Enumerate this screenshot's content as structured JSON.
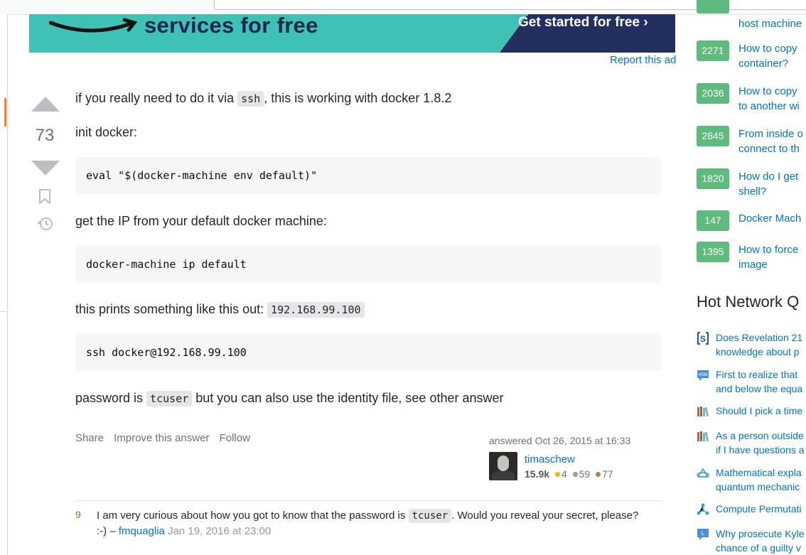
{
  "ad": {
    "headline": "services for free",
    "cta": "Get started for free ›",
    "report_link": "Report this ad"
  },
  "answer": {
    "score": "73",
    "p1_before": "if you really need to do it via ",
    "p1_code": "ssh",
    "p1_after": ", this is working with docker 1.8.2",
    "p2": "init docker:",
    "code1": "eval \"$(docker-machine env default)\"",
    "p3": "get the IP from your default docker machine:",
    "code2": "docker-machine ip default",
    "p4_before": "this prints something like this out: ",
    "p4_code": "192.168.99.100",
    "code3": "ssh docker@192.168.99.100",
    "p5_before": "password is ",
    "p5_code": "tcuser",
    "p5_after": " but you can also use the identity file, see other answer"
  },
  "actions": {
    "share": "Share",
    "improve": "Improve this answer",
    "follow": "Follow"
  },
  "author": {
    "answered": "answered Oct 26, 2015 at 16:33",
    "name": "timaschew",
    "reputation": "15.9k",
    "gold": "4",
    "silver": "59",
    "bronze": "77",
    "colors": {
      "gold": "#f1b600",
      "silver": "#9a9c9f",
      "bronze": "#ab825f"
    }
  },
  "comment": {
    "score": "9",
    "text_before": "I am very curious about how you got to know that the password is ",
    "code": "tcuser",
    "text_after": ". Would you reveal your secret, please? :-) – ",
    "user": "fmquaglia",
    "date": "Jan 19, 2016 at 23:00"
  },
  "linked": [
    {
      "count": "",
      "title_l1": "host machine",
      "title_l2": ""
    },
    {
      "count": "2271",
      "title_l1": "How to copy",
      "title_l2": "container?"
    },
    {
      "count": "2036",
      "title_l1": "How to copy",
      "title_l2": "to another wi"
    },
    {
      "count": "2845",
      "title_l1": "From inside o",
      "title_l2": "connect to th"
    },
    {
      "count": "1820",
      "title_l1": "How do I get",
      "title_l2": "shell?"
    },
    {
      "count": "147",
      "title_l1": "Docker Mach",
      "title_l2": ""
    },
    {
      "count": "1395",
      "title_l1": "How to force",
      "title_l2": "image"
    }
  ],
  "hot_network_title": "Hot Network Q",
  "hot_network": [
    {
      "icon": "stack-exchange-s-icon",
      "l1": "Does Revelation 21",
      "l2": "knowledge about p"
    },
    {
      "icon": "hsm-icon",
      "l1": "First to realize that",
      "l2": "and below the equa"
    },
    {
      "icon": "books-icon",
      "l1": "Should I pick a time",
      "l2": ""
    },
    {
      "icon": "books-icon",
      "l1": "As a person outside",
      "l2": "if I have questions a"
    },
    {
      "icon": "physics-icon",
      "l1": "Mathematical expla",
      "l2": "quantum mechanic"
    },
    {
      "icon": "graph-icon",
      "l1": "Compute Permutati",
      "l2": ""
    },
    {
      "icon": "law-icon",
      "l1": "Why prosecute Kyle",
      "l2": "chance of a guilty v"
    }
  ]
}
